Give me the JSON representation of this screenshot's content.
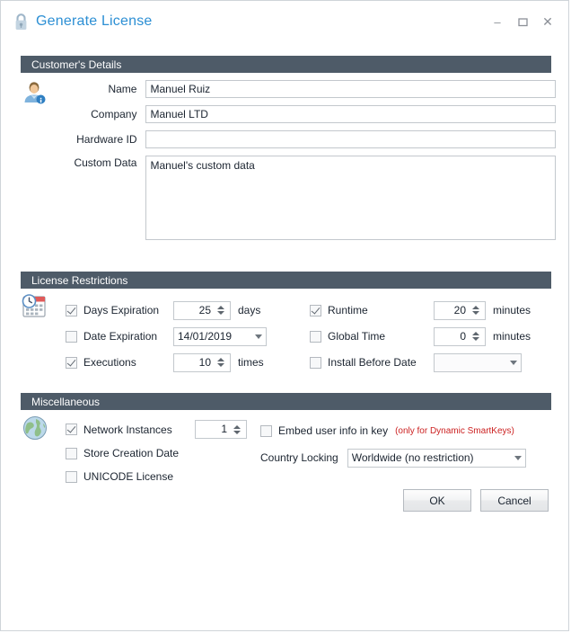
{
  "window": {
    "title": "Generate License",
    "title_icon": "lock-icon",
    "controls": {
      "minimize": "–",
      "maximize": "❒",
      "close": "✕"
    }
  },
  "customer_details": {
    "header": "Customer's Details",
    "icon": "user-info-icon",
    "fields": [
      {
        "label": "Name",
        "value": "Manuel Ruiz",
        "placeholder": ""
      },
      {
        "label": "Company",
        "value": "Manuel LTD",
        "placeholder": ""
      },
      {
        "label": "Hardware ID",
        "value": "",
        "placeholder": ""
      }
    ],
    "custom_data": {
      "label": "Custom Data",
      "value": "Manuel's custom data",
      "placeholder": ""
    }
  },
  "license_restrictions": {
    "header": "License Restrictions",
    "icon": "calendar-clock-icon",
    "left": [
      {
        "label": "Days Expiration",
        "checked": true,
        "control": "spinner",
        "value": "25",
        "unit": "days"
      },
      {
        "label": "Date Expiration",
        "checked": false,
        "control": "combo",
        "value": "14/01/2019",
        "unit": ""
      },
      {
        "label": "Executions",
        "checked": true,
        "control": "spinner",
        "value": "10",
        "unit": "times"
      }
    ],
    "right": [
      {
        "label": "Runtime",
        "checked": true,
        "control": "spinner",
        "value": "20",
        "unit": "minutes"
      },
      {
        "label": "Global Time",
        "checked": false,
        "control": "spinner",
        "value": "0",
        "unit": "minutes"
      },
      {
        "label": "Install Before Date",
        "checked": false,
        "control": "combo",
        "value": "",
        "unit": ""
      }
    ]
  },
  "miscellaneous": {
    "header": "Miscellaneous",
    "icon": "globe-icon",
    "network_instances": {
      "label": "Network Instances",
      "checked": true,
      "value": "1"
    },
    "store_creation_date": {
      "label": "Store Creation Date",
      "checked": false
    },
    "unicode_license": {
      "label": "UNICODE License",
      "checked": false
    },
    "embed_user_info": {
      "label": "Embed user info in key",
      "checked": false,
      "hint": "(only for Dynamic SmartKeys)"
    },
    "country_locking": {
      "label": "Country Locking",
      "value": "Worldwide (no restriction)"
    }
  },
  "footer": {
    "ok_label": "OK",
    "cancel_label": "Cancel"
  },
  "colors": {
    "title_blue": "#2c8fd4",
    "section_header_bg": "#4e5b68",
    "hint_red": "#cc2222"
  }
}
